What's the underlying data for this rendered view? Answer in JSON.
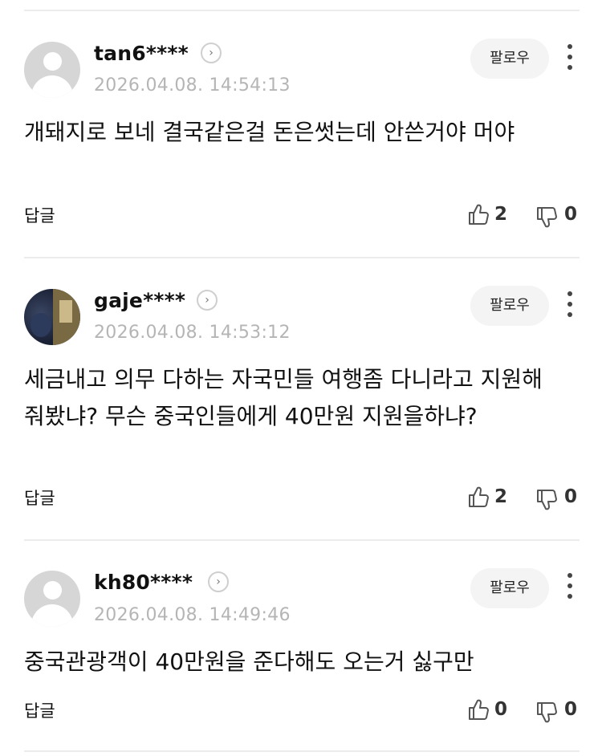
{
  "comments": [
    {
      "username": "tan6****",
      "timestamp": "2026.04.08. 14:54:13",
      "follow_label": "팔로우",
      "text": "개돼지로 보네 결국같은걸 돈은썻는데 안쓴거야 머야",
      "reply_label": "답글",
      "likes": "2",
      "dislikes": "0",
      "avatar": "default-avatar-icon"
    },
    {
      "username": "gaje****",
      "timestamp": "2026.04.08. 14:53:12",
      "follow_label": "팔로우",
      "text": "세금내고 의무 다하는 자국민들 여행좀 다니라고 지원해줘봤냐? 무슨 중국인들에게 40만원 지원을하냐?",
      "reply_label": "답글",
      "likes": "2",
      "dislikes": "0",
      "avatar": "profile-photo"
    },
    {
      "username": "kh80****",
      "timestamp": "2026.04.08. 14:49:46",
      "follow_label": "팔로우",
      "text": "중국관광객이 40만원을 준다해도 오는거 싫구만",
      "reply_label": "답글",
      "likes": "0",
      "dislikes": "0",
      "avatar": "default-avatar-icon"
    }
  ],
  "icons": {
    "profile_chevron": "chevron-right-icon",
    "more": "more-vertical-icon",
    "like": "thumbs-up-icon",
    "dislike": "thumbs-down-icon"
  },
  "colors": {
    "timestamp": "#b5b5b5",
    "follow_bg": "#f4f4f4",
    "divider": "#ececec"
  }
}
